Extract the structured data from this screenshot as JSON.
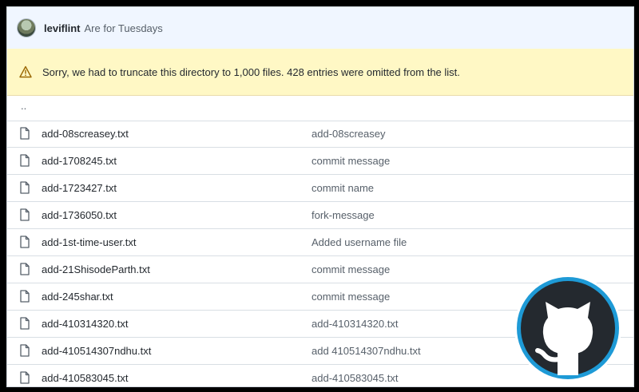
{
  "commit": {
    "user": "leviflint",
    "message": "Are for Tuesdays"
  },
  "warning": {
    "text": "Sorry, we had to truncate this directory to 1,000 files. 428 entries were omitted from the list."
  },
  "parent_link": "..",
  "files": [
    {
      "name": "add-08screasey.txt",
      "message": "add-08screasey"
    },
    {
      "name": "add-1708245.txt",
      "message": "commit message"
    },
    {
      "name": "add-1723427.txt",
      "message": "commit name"
    },
    {
      "name": "add-1736050.txt",
      "message": "fork-message"
    },
    {
      "name": "add-1st-time-user.txt",
      "message": "Added username file"
    },
    {
      "name": "add-21ShisodeParth.txt",
      "message": "commit message"
    },
    {
      "name": "add-245shar.txt",
      "message": "commit message"
    },
    {
      "name": "add-410314320.txt",
      "message": "add-410314320.txt"
    },
    {
      "name": "add-410514307ndhu.txt",
      "message": "add 410514307ndhu.txt"
    },
    {
      "name": "add-410583045.txt",
      "message": "add-410583045.txt"
    }
  ],
  "icons": {
    "avatar": "avatar-image",
    "warning": "alert-triangle-icon",
    "file": "file-icon",
    "logo": "github-logo"
  },
  "colors": {
    "commit_bar_bg": "#f0f6ff",
    "warning_bg": "#fff8c5",
    "logo_ring": "#1e9ad6",
    "logo_bg": "#24292f"
  }
}
